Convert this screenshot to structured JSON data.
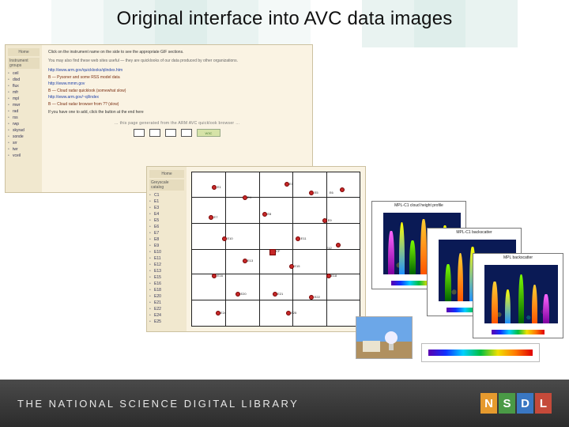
{
  "title": "Original interface into AVC data images",
  "footer": {
    "text": "THE NATIONAL SCIENCE DIGITAL LIBRARY",
    "logo": [
      "N",
      "S",
      "D",
      "L"
    ]
  },
  "panel1": {
    "sidebar": {
      "home": "Home",
      "group_label": "Instrument groups",
      "items": [
        "ceil",
        "disd",
        "flux",
        "mfr",
        "mpl",
        "mwr",
        "rad",
        "rss",
        "rwp",
        "skyrad",
        "sonde",
        "srr",
        "twr",
        "vceil"
      ]
    },
    "main": {
      "intro": "Click on the instrument name on the side to see the appropriate GIF sections.",
      "sub": "You may also find these web sites useful — they are quicklooks of our data produced by other organizations.",
      "links": [
        {
          "url": "http://www.arm.gov/quicklooks/qlindex.htm",
          "label": "B — Pysoner and some RSS model data"
        },
        {
          "url": "http://www.mmm.gov",
          "label": "B — Cloud radar quicklook (somewhat slow)"
        },
        {
          "url": "http://www.arm.gov/~ql/index",
          "label": "B — Cloud radar browser from ?? (slow)"
        }
      ],
      "note": "If you have one to add, click the button at the end here",
      "footer_line": "… this page generated from the ARM AVC quicklook browser …"
    }
  },
  "panel2": {
    "sidebar": {
      "home": "Home",
      "group": "Greyscale catalog",
      "items": [
        "C1",
        "E1",
        "E3",
        "E4",
        "E5",
        "E6",
        "E7",
        "E8",
        "E9",
        "E10",
        "E11",
        "E12",
        "E13",
        "E15",
        "E16",
        "E18",
        "E20",
        "E21",
        "E22",
        "E24",
        "E25"
      ]
    },
    "map": {
      "counties": [
        "E1",
        "E3",
        "E4",
        "E5",
        "E6",
        "E7",
        "E8",
        "E9",
        "E10",
        "E11",
        "E12",
        "E13",
        "E15",
        "E16",
        "E18",
        "E20",
        "E21",
        "E22",
        "E24",
        "E25"
      ],
      "central_facility": "CF"
    }
  },
  "plots": {
    "a_title": "MPL-C1 cloud height profile",
    "b_title": "MPL-C1 backscatter",
    "c_title": "MPL backscatter"
  }
}
